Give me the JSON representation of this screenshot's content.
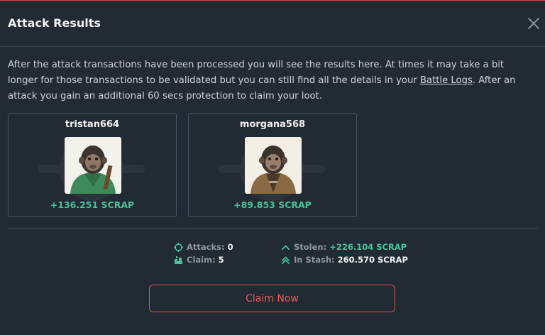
{
  "modal": {
    "title": "Attack Results",
    "description_pre": "After the attack transactions have been processed you will see the results here. At times it may take a bit longer for those transactions to be validated but you can still find all the details in your ",
    "description_link": "Battle Logs",
    "description_post": ". After an attack you gain an additional 60 secs protection to claim your loot."
  },
  "players": [
    {
      "name": "tristan664",
      "gain": "+136.251 SCRAP",
      "avatar": "ape-green-jacket"
    },
    {
      "name": "morgana568",
      "gain": "+89.853 SCRAP",
      "avatar": "ape-brown-coat"
    }
  ],
  "stats": {
    "attacks_label": "Attacks:",
    "attacks_value": "0",
    "claim_label": "Claim:",
    "claim_value": "5",
    "stolen_label": "Stolen:",
    "stolen_value": "+226.104 SCRAP",
    "stash_label": "In Stash:",
    "stash_value": "260.570 SCRAP"
  },
  "actions": {
    "claim_label": "Claim Now"
  },
  "colors": {
    "accent": "#e0544f",
    "gain": "#47c49a",
    "background": "#222a33"
  }
}
